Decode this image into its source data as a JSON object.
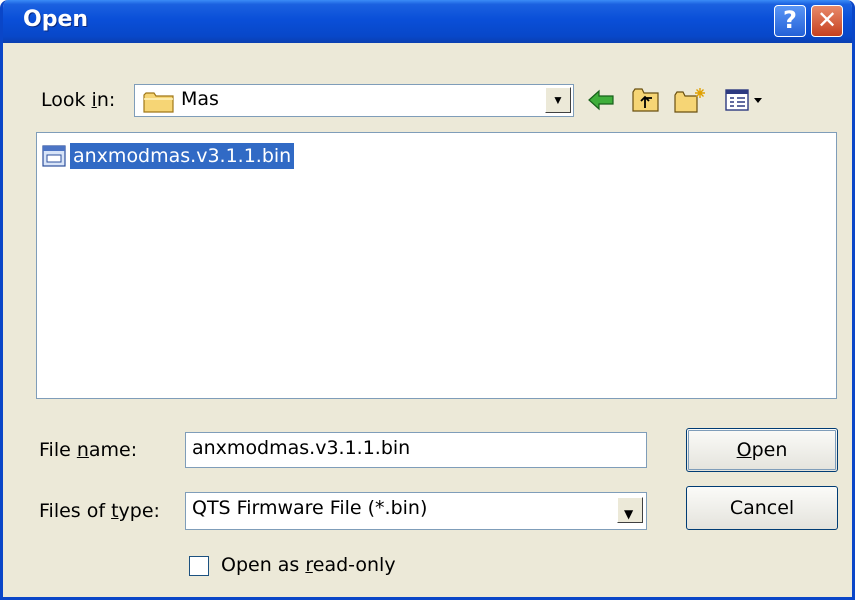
{
  "window": {
    "title": "Open",
    "help_glyph": "?",
    "close_glyph": "✕"
  },
  "lookin": {
    "label_pre": "Look ",
    "label_accel": "i",
    "label_post": "n:",
    "value": "Mas"
  },
  "toolbar": {
    "icons": [
      "back-arrow-icon",
      "up-folder-icon",
      "new-folder-icon",
      "view-menu-icon"
    ]
  },
  "files": [
    {
      "name": "anxmodmas.v3.1.1.bin",
      "selected": true,
      "icon": "bin-file-icon"
    }
  ],
  "filename": {
    "label_pre": "File ",
    "label_accel": "n",
    "label_post": "ame:",
    "value": "anxmodmas.v3.1.1.bin"
  },
  "filetype": {
    "label_pre": "Files of ",
    "label_accel": "t",
    "label_post": "ype:",
    "value": "QTS Firmware File (*.bin)"
  },
  "buttons": {
    "open_accel": "O",
    "open_rest": "pen",
    "cancel": "Cancel"
  },
  "readonly": {
    "label_pre": "Open as ",
    "label_accel": "r",
    "label_post": "ead-only",
    "checked": false
  },
  "colors": {
    "titlebar": "#0a4fd8",
    "selection": "#316ac5",
    "face": "#ece9d8"
  }
}
